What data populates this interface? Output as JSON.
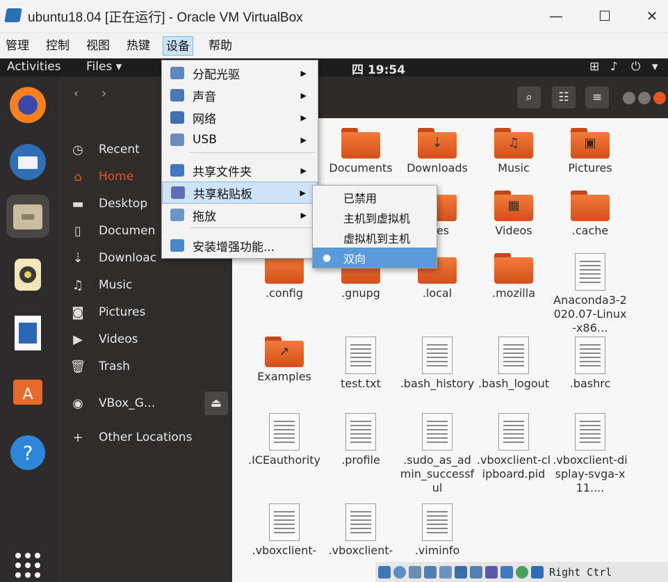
{
  "window": {
    "title": "ubuntu18.04 [正在运行] - Oracle VM VirtualBox",
    "controls": {
      "minimize": "—",
      "maximize": "☐",
      "close": "✕"
    }
  },
  "vbox_menu": [
    {
      "label": "管理"
    },
    {
      "label": "控制"
    },
    {
      "label": "视图"
    },
    {
      "label": "热键"
    },
    {
      "label": "设备",
      "active": true
    },
    {
      "label": "帮助"
    }
  ],
  "devices_menu": {
    "items": [
      {
        "label": "分配光驱",
        "icon": "optical-disc-icon",
        "submenu": true
      },
      {
        "label": "声音",
        "icon": "audio-icon",
        "submenu": true
      },
      {
        "label": "网络",
        "icon": "network-icon",
        "submenu": true
      },
      {
        "label": "USB",
        "icon": "usb-icon",
        "submenu": true
      },
      {
        "label": "共享文件夹",
        "icon": "shared-folder-icon",
        "submenu": true
      },
      {
        "label": "共享粘贴板",
        "icon": "shared-clipboard-icon",
        "submenu": true,
        "highlighted": true
      },
      {
        "label": "拖放",
        "icon": "drag-drop-icon",
        "submenu": true
      },
      {
        "label": "安装增强功能...",
        "icon": "install-additions-icon",
        "submenu": false
      }
    ]
  },
  "clipboard_submenu": {
    "items": [
      {
        "label": "已禁用"
      },
      {
        "label": "主机到虚拟机"
      },
      {
        "label": "虚拟机到主机"
      },
      {
        "label": "双向",
        "selected": true
      }
    ]
  },
  "ubuntu_topbar": {
    "activities": "Activities",
    "app_menu": "Files ▾",
    "clock": "四 19:54"
  },
  "dock": [
    {
      "icon": "firefox-icon",
      "color": "#e66000"
    },
    {
      "icon": "thunderbird-icon",
      "color": "#2f6db5"
    },
    {
      "icon": "files-icon",
      "color": "#b9aa8f"
    },
    {
      "icon": "rhythmbox-icon",
      "color": "#e8d25c"
    },
    {
      "icon": "writer-icon",
      "color": "#2d66b5"
    },
    {
      "icon": "software-icon",
      "color": "#e66b2a"
    },
    {
      "icon": "help-icon",
      "color": "#2f86d8"
    },
    {
      "icon": "show-apps-icon",
      "color": "#ffffff"
    }
  ],
  "sidebar": {
    "items": [
      {
        "label": "Recent",
        "icon": "clock-icon",
        "glyph": "◷"
      },
      {
        "label": "Home",
        "icon": "home-icon",
        "glyph": "⌂",
        "selected": true
      },
      {
        "label": "Desktop",
        "icon": "desktop-folder-icon",
        "glyph": "▬"
      },
      {
        "label": "Documen",
        "icon": "document-icon",
        "glyph": "▯"
      },
      {
        "label": "Downloac",
        "icon": "download-icon",
        "glyph": "⇣"
      },
      {
        "label": "Music",
        "icon": "music-icon",
        "glyph": "♫"
      },
      {
        "label": "Pictures",
        "icon": "camera-icon",
        "glyph": "◙"
      },
      {
        "label": "Videos",
        "icon": "video-icon",
        "glyph": "▶"
      },
      {
        "label": "Trash",
        "icon": "trash-icon",
        "glyph": "🗑"
      },
      {
        "label": "VBox_G...",
        "icon": "disc-icon",
        "glyph": "◉"
      },
      {
        "label": "Other Locations",
        "icon": "plus-icon",
        "glyph": "+"
      }
    ]
  },
  "files": [
    {
      "name": "Documents",
      "kind": "folder",
      "glyph": ""
    },
    {
      "name": "Downloads",
      "kind": "folder",
      "glyph": "⇣"
    },
    {
      "name": "Music",
      "kind": "folder",
      "glyph": "♫"
    },
    {
      "name": "Pictures",
      "kind": "folder",
      "glyph": "▣"
    },
    {
      "name": "ates",
      "kind": "folder",
      "glyph": ""
    },
    {
      "name": "Videos",
      "kind": "folder",
      "glyph": "▦"
    },
    {
      "name": ".cache",
      "kind": "folder",
      "glyph": ""
    },
    {
      "name": ".config",
      "kind": "folder",
      "glyph": ""
    },
    {
      "name": ".gnupg",
      "kind": "folder",
      "glyph": ""
    },
    {
      "name": ".local",
      "kind": "folder",
      "glyph": ""
    },
    {
      "name": ".mozilla",
      "kind": "folder",
      "glyph": ""
    },
    {
      "name": "Anaconda3-2020.07-Linux-x86…",
      "kind": "doc"
    },
    {
      "name": "Examples",
      "kind": "folder",
      "glyph": "↗"
    },
    {
      "name": "test.txt",
      "kind": "doc"
    },
    {
      "name": ".bash_history",
      "kind": "doc"
    },
    {
      "name": ".bash_logout",
      "kind": "doc"
    },
    {
      "name": ".bashrc",
      "kind": "doc"
    },
    {
      "name": ".ICEauthority",
      "kind": "doc"
    },
    {
      "name": ".profile",
      "kind": "doc"
    },
    {
      "name": ".sudo_as_admin_successful",
      "kind": "doc"
    },
    {
      "name": ".vboxclient-clipboard.pid",
      "kind": "doc"
    },
    {
      "name": ".vboxclient-display-svga-x11....",
      "kind": "doc"
    },
    {
      "name": ".vboxclient-",
      "kind": "doc"
    },
    {
      "name": ".vboxclient-",
      "kind": "doc"
    },
    {
      "name": ".viminfo",
      "kind": "doc"
    }
  ],
  "statusbar": {
    "host_key": "Right Ctrl"
  }
}
